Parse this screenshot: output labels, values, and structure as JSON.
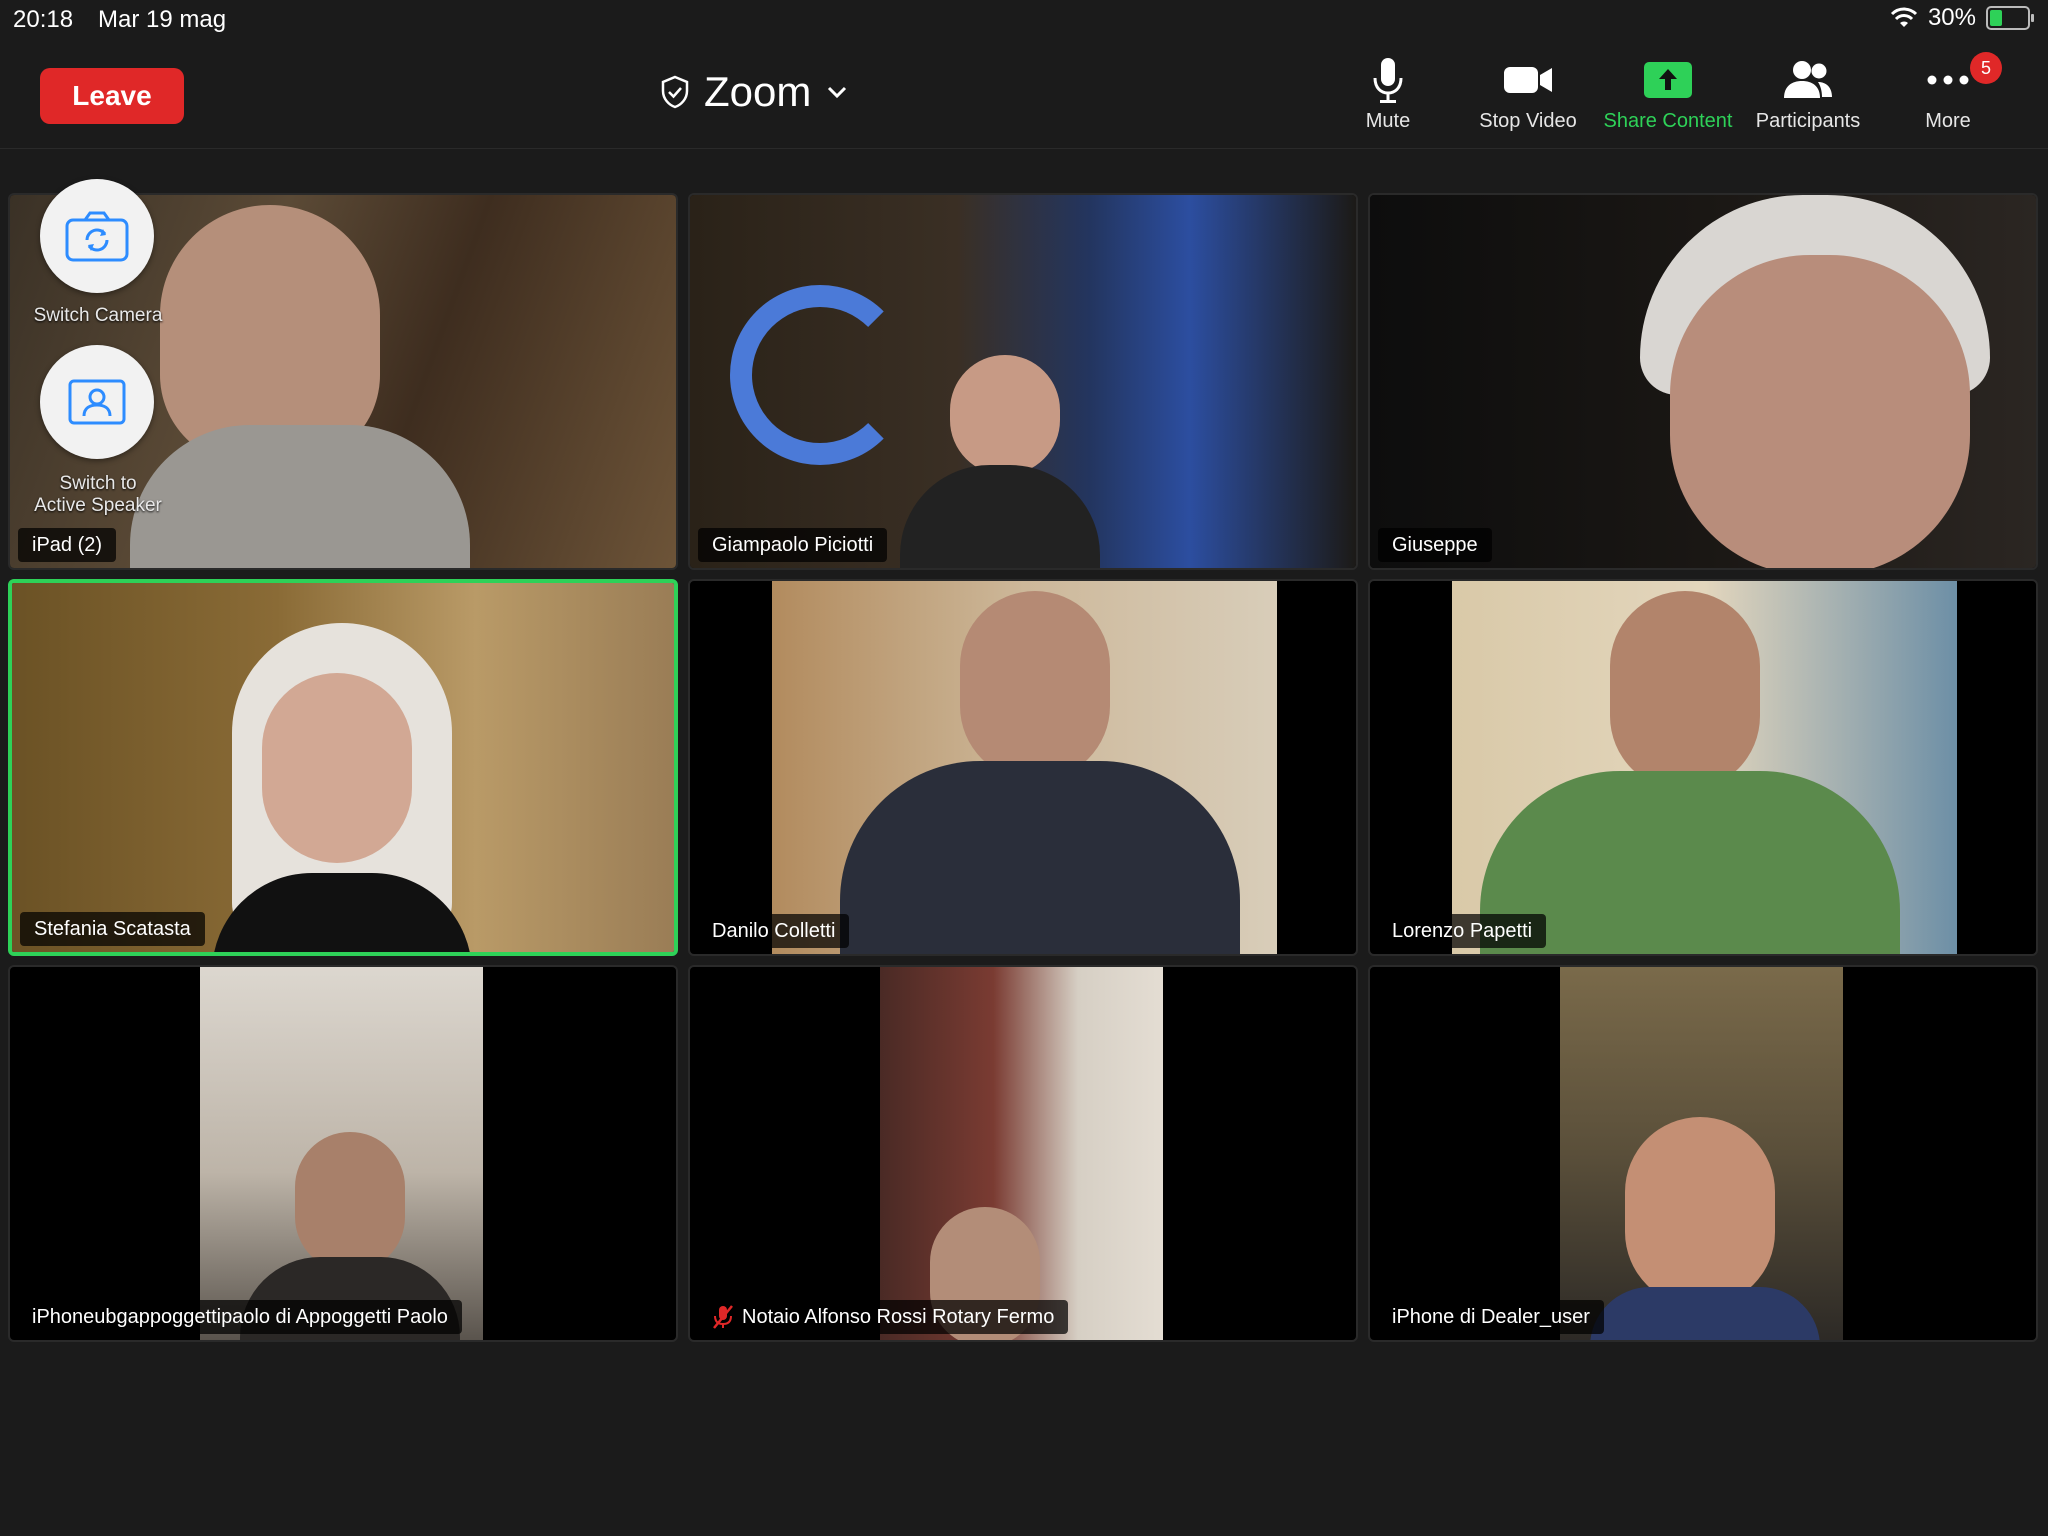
{
  "status_bar": {
    "time": "20:18",
    "date": "Mar 19 mag",
    "battery": "30%",
    "battery_level": 0.3
  },
  "header": {
    "leave_label": "Leave",
    "title": "Zoom",
    "title_icon": "shield-check-icon",
    "dropdown_icon": "chevron-down-icon"
  },
  "toolbar": {
    "mute": {
      "label": "Mute",
      "icon": "microphone-icon"
    },
    "stop_video": {
      "label": "Stop Video",
      "icon": "video-camera-icon"
    },
    "share_content": {
      "label": "Share Content",
      "icon": "share-arrow-icon"
    },
    "participants": {
      "label": "Participants",
      "icon": "people-icon"
    },
    "more": {
      "label": "More",
      "icon": "ellipsis-icon",
      "badge": "5"
    }
  },
  "overlay": {
    "switch_camera": "Switch Camera",
    "switch_speaker_line1": "Switch to",
    "switch_speaker_line2": "Active Speaker"
  },
  "participants": [
    {
      "name": "iPad (2)"
    },
    {
      "name": "Giampaolo Piciotti"
    },
    {
      "name": "Giuseppe"
    },
    {
      "name": "Stefania Scatasta"
    },
    {
      "name": "Danilo Colletti"
    },
    {
      "name": "Lorenzo Papetti"
    },
    {
      "name": "iPhoneubgappoggettipaolo di Appoggetti Paolo"
    },
    {
      "name": "Notaio Alfonso Rossi Rotary Fermo"
    },
    {
      "name": "iPhone di Dealer_user"
    }
  ],
  "colors": {
    "leave": "#e02828",
    "share": "#2ed158",
    "active_speaker": "#2ed158",
    "muted": "#e02828"
  }
}
